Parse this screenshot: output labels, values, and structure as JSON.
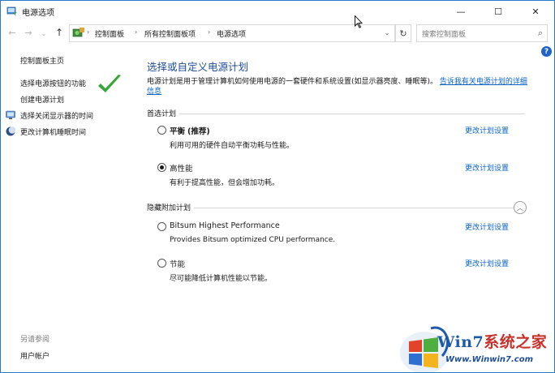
{
  "window": {
    "title": "电源选项"
  },
  "titlebar_buttons": {
    "minimize": "—",
    "maximize": "☐",
    "close": "✕"
  },
  "address": {
    "breadcrumb": [
      "控制面板",
      "所有控制面板项",
      "电源选项"
    ],
    "search_placeholder": "搜索控制面板"
  },
  "sidebar": {
    "home": "控制面板主页",
    "links": [
      {
        "label": "选择电源按钮的功能",
        "icon": "none"
      },
      {
        "label": "创建电源计划",
        "icon": "none"
      },
      {
        "label": "选择关闭显示器的时间",
        "icon": "monitor-icon"
      },
      {
        "label": "更改计算机睡眠时间",
        "icon": "moon-icon"
      }
    ],
    "see_also": "另请参阅",
    "see_also_links": [
      "用户帐户"
    ]
  },
  "main": {
    "title": "选择或自定义电源计划",
    "description": "电源计划是用于管理计算机如何使用电源的一套硬件和系统设置(如显示器亮度、睡眠等)。",
    "description_link": "告诉我有关电源计划的详细信息",
    "preferred_heading": "首选计划",
    "hidden_heading": "隐藏附加计划",
    "change_link": "更改计划设置",
    "plans": [
      {
        "name": "平衡",
        "tag": "(推荐)",
        "desc": "利用可用的硬件自动平衡功耗与性能。",
        "selected": false
      },
      {
        "name": "高性能",
        "tag": "",
        "desc": "有利于提高性能，但会增加功耗。",
        "selected": true
      },
      {
        "name": "Bitsum Highest Performance",
        "tag": "",
        "desc": "Provides Bitsum optimized CPU performance.",
        "selected": false
      },
      {
        "name": "节能",
        "tag": "",
        "desc": "尽可能降低计算机性能以节能。",
        "selected": false
      }
    ]
  },
  "watermark": {
    "brand_w": "Win7",
    "brand_rest": "系统之家",
    "url": "Www.Winwin7.com"
  },
  "colors": {
    "link": "#0a64c8",
    "title": "#1e4e9a",
    "accent": "#2b79c9"
  }
}
